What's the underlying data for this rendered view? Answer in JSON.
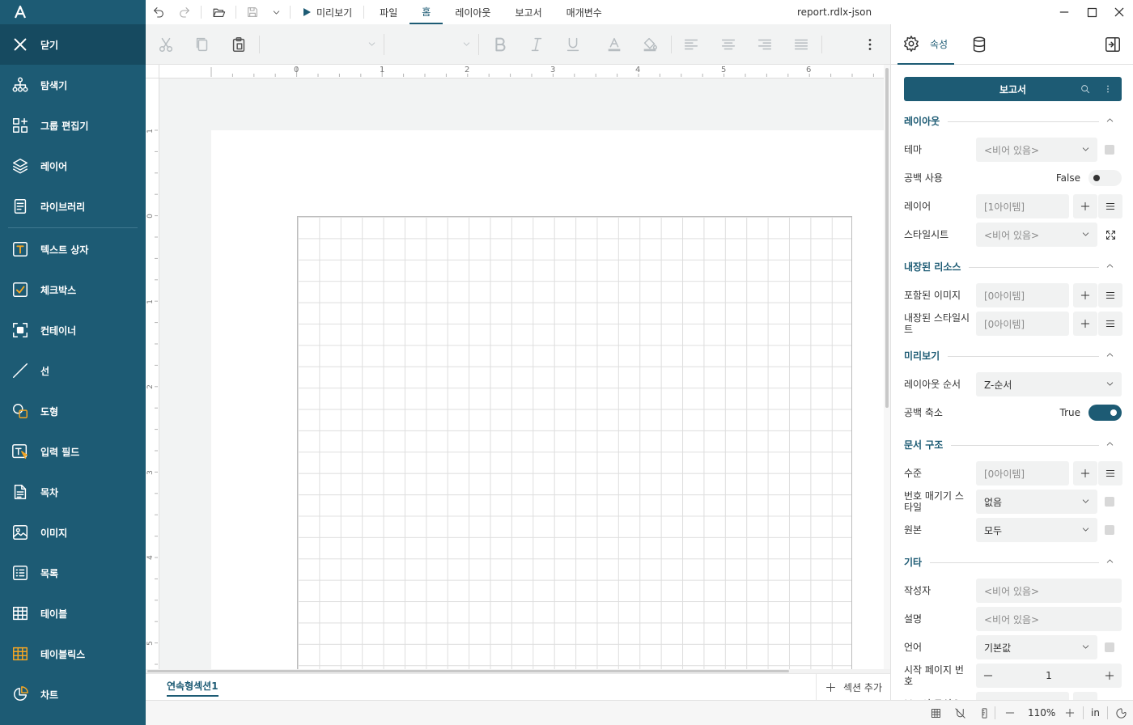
{
  "app": {
    "filename": "report.rdlx-json",
    "preview_label": "미리보기",
    "menus": [
      "파일",
      "홈",
      "레이아웃",
      "보고서",
      "매개변수"
    ],
    "active_menu_index": 1
  },
  "sidebar": {
    "close_label": "닫기",
    "items": [
      {
        "label": "탐색기",
        "icon": "explorer-icon"
      },
      {
        "label": "그룹 편집기",
        "icon": "group-editor-icon"
      },
      {
        "label": "레이어",
        "icon": "layers-icon"
      },
      {
        "label": "라이브러리",
        "icon": "library-icon"
      },
      {
        "label": "텍스트 상자",
        "icon": "textbox-icon"
      },
      {
        "label": "체크박스",
        "icon": "checkbox-icon"
      },
      {
        "label": "컨테이너",
        "icon": "container-icon"
      },
      {
        "label": "선",
        "icon": "line-icon"
      },
      {
        "label": "도형",
        "icon": "shape-icon"
      },
      {
        "label": "입력 필드",
        "icon": "input-field-icon"
      },
      {
        "label": "목차",
        "icon": "toc-icon"
      },
      {
        "label": "이미지",
        "icon": "image-icon"
      },
      {
        "label": "목록",
        "icon": "list-icon"
      },
      {
        "label": "테이블",
        "icon": "table-icon"
      },
      {
        "label": "테이블릭스",
        "icon": "tablix-icon"
      },
      {
        "label": "차트",
        "icon": "chart-icon"
      }
    ]
  },
  "ruler": {
    "top_labels": [
      "0",
      "1",
      "2",
      "3",
      "4",
      "5",
      "6"
    ],
    "left_labels": [
      "1",
      "0",
      "1",
      "2",
      "3",
      "4",
      "5"
    ]
  },
  "sections": {
    "tab_label": "연속형섹션1",
    "add_label": "섹션 추가"
  },
  "status": {
    "zoom": "110%",
    "unit": "in"
  },
  "panel": {
    "tab_label": "속성",
    "header_title": "보고서",
    "groups": [
      {
        "title": "레이아웃"
      },
      {
        "title": "내장된 리소스"
      },
      {
        "title": "미리보기"
      },
      {
        "title": "문서 구조"
      },
      {
        "title": "기타"
      }
    ],
    "layout": {
      "theme_label": "테마",
      "theme_value": "<비어 있음>",
      "margins_label": "공백 사용",
      "margins_value": "False",
      "layers_label": "레이어",
      "layers_value": "[1아이템]",
      "stylesheet_label": "스타일시트",
      "stylesheet_value": "<비어 있음>"
    },
    "resources": {
      "images_label": "포함된 이미지",
      "images_value": "[0아이템]",
      "styles_label": "내장된 스타일시트",
      "styles_value": "[0아이템]"
    },
    "preview": {
      "order_label": "레이아웃 순서",
      "order_value": "Z-순서",
      "shrink_label": "공백 축소",
      "shrink_value": "True"
    },
    "docmap": {
      "levels_label": "수준",
      "levels_value": "[0아이템]",
      "numbering_label": "번호 매기기 스타일",
      "numbering_value": "없음",
      "source_label": "원본",
      "source_value": "모두"
    },
    "misc": {
      "author_label": "작성자",
      "author_value": "<비어 있음>",
      "desc_label": "설명",
      "desc_value": "<비어 있음>",
      "lang_label": "언어",
      "lang_value": "기본값",
      "startpage_label": "시작 페이지 번호",
      "startpage_value": "1",
      "composition_label": "보고서 구성요"
    }
  }
}
